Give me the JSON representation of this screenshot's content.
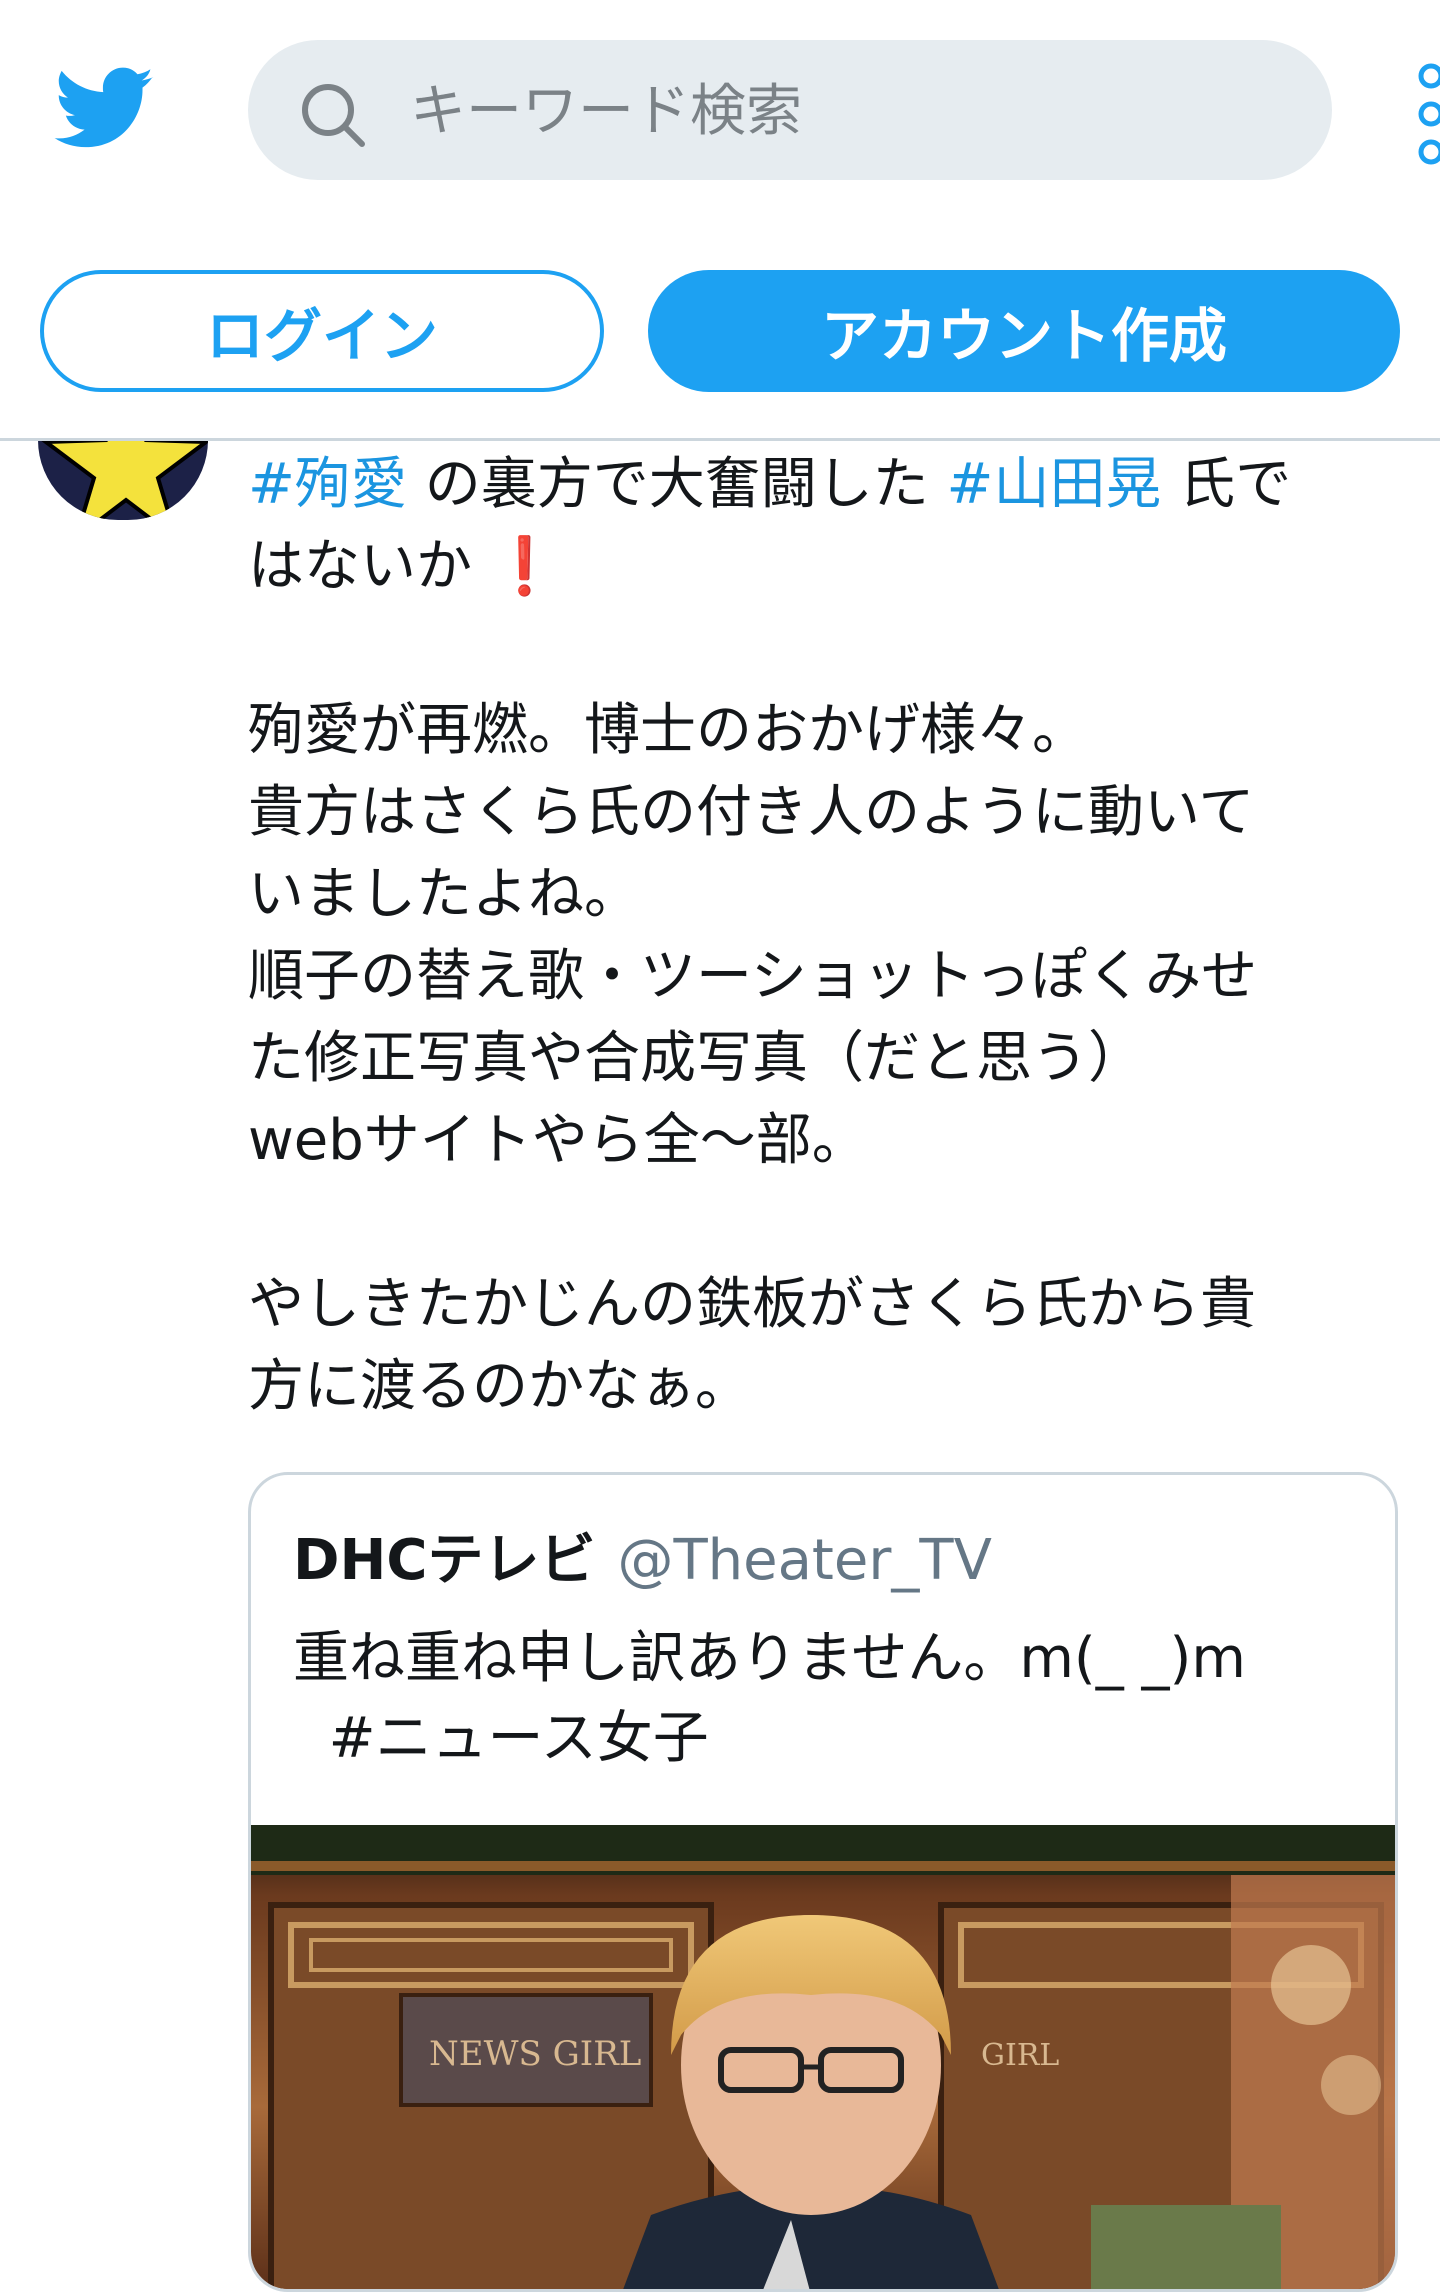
{
  "header": {
    "search": {
      "placeholder": "キーワード検索"
    },
    "login_label": "ログイン",
    "signup_label": "アカウント作成"
  },
  "colors": {
    "brand": "#1da1f2",
    "hashtag": "#1b95e0",
    "exclamation": "#e0243a"
  },
  "tweet": {
    "lines": [
      {
        "seg": [
          "#殉愛",
          " の裏方で大奮闘した ",
          "#山田晃",
          " 氏で"
        ]
      },
      {
        "text": "はないか ",
        "emoji": "❗"
      },
      {
        "text": "殉愛が再燃。博士のおかげ様々。"
      },
      {
        "text": "貴方はさくら氏の付き人のように動いて"
      },
      {
        "text": "いましたよね。"
      },
      {
        "text": "順子の替え歌・ツーショットっぽくみせ"
      },
      {
        "text": "た修正写真や合成写真（だと思う）"
      },
      {
        "text": "webサイトやら全〜部。"
      },
      {
        "text": "やしきたかじんの鉄板がさくら氏から貴"
      },
      {
        "text": "方に渡るのかなぁ。"
      }
    ]
  },
  "quoted": {
    "name": "DHCテレビ",
    "handle": "@Theater_TV",
    "line1": "重ね重ね申し訳ありません。m(_ _)m",
    "line2": "#ニュース女子",
    "image_sign_left": "NEWS GIRL",
    "image_sign_right": "GIRL"
  }
}
